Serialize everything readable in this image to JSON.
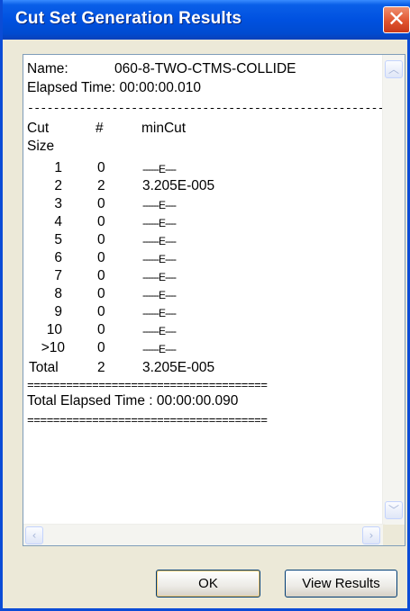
{
  "window": {
    "title": "Cut Set Generation Results"
  },
  "results": {
    "name_label": "Name:",
    "name_value": "060-8-TWO-CTMS-COLLIDE",
    "elapsed": "Elapsed Time: 00:00:00.010",
    "separator_dash": "----------------------------------------------------------",
    "headers": {
      "cut": "Cut",
      "size": "Size",
      "count": "#",
      "mincut": "minCut"
    },
    "rows": [
      {
        "size": "1",
        "count": "0",
        "mincut": "------E----"
      },
      {
        "size": "2",
        "count": "2",
        "mincut": "3.205E-005"
      },
      {
        "size": "3",
        "count": "0",
        "mincut": "------E----"
      },
      {
        "size": "4",
        "count": "0",
        "mincut": "------E----"
      },
      {
        "size": "5",
        "count": "0",
        "mincut": "------E----"
      },
      {
        "size": "6",
        "count": "0",
        "mincut": "------E----"
      },
      {
        "size": "7",
        "count": "0",
        "mincut": "------E----"
      },
      {
        "size": "8",
        "count": "0",
        "mincut": "------E----"
      },
      {
        "size": "9",
        "count": "0",
        "mincut": "------E----"
      },
      {
        "size": "10",
        "count": "0",
        "mincut": "------E----"
      },
      {
        "size": ">10",
        "count": "0",
        "mincut": "------E----"
      }
    ],
    "total": {
      "label": "Total",
      "count": "2",
      "mincut": "3.205E-005"
    },
    "separator_eq": "=====================================",
    "total_elapsed": "Total Elapsed Time : 00:00:00.090"
  },
  "buttons": {
    "ok": "OK",
    "view_results": "View Results"
  },
  "icons": {
    "close": "close-icon",
    "scroll_up": "arrow-up-icon",
    "scroll_down": "arrow-down-icon",
    "scroll_left": "arrow-left-icon",
    "scroll_right": "arrow-right-icon"
  }
}
